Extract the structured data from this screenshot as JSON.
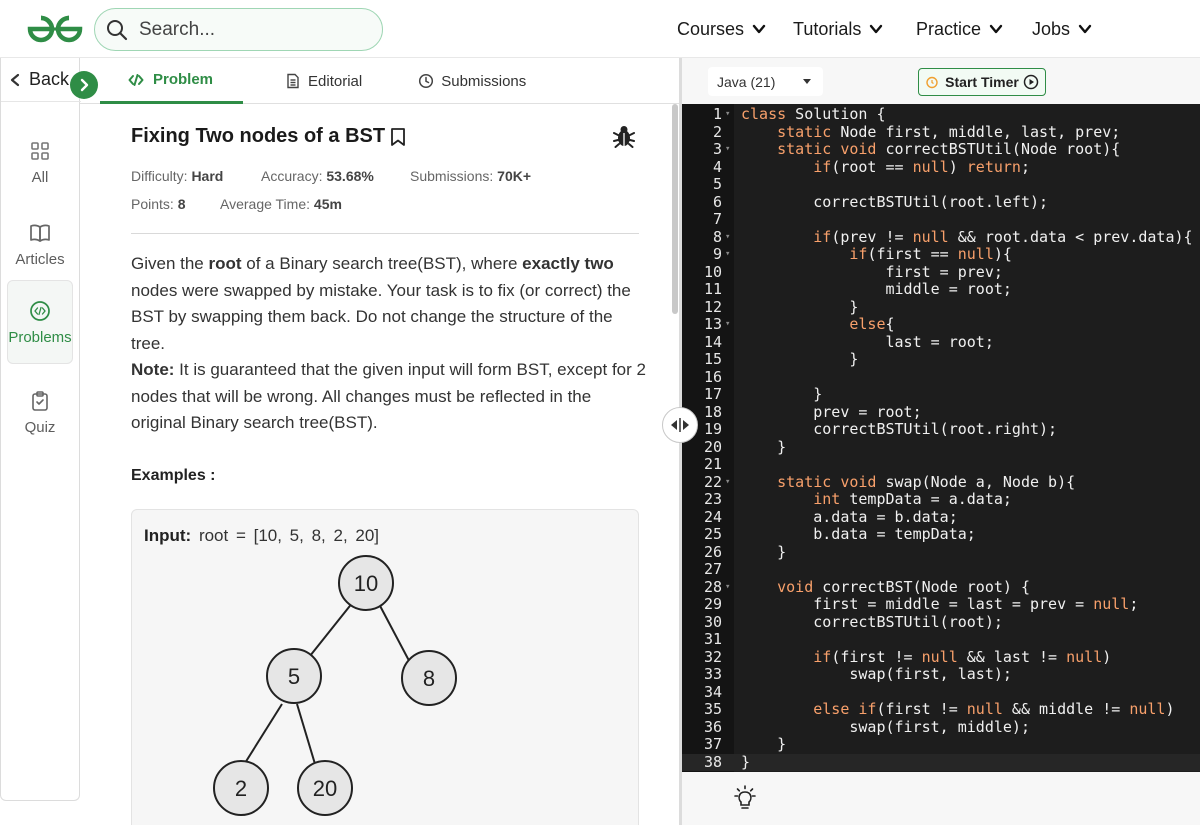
{
  "header": {
    "search_placeholder": "Search...",
    "nav": [
      "Courses",
      "Tutorials",
      "Practice",
      "Jobs"
    ]
  },
  "rail": {
    "back": "Back",
    "items": [
      {
        "label": "All",
        "icon": "grid-icon"
      },
      {
        "label": "Articles",
        "icon": "book-icon"
      },
      {
        "label": "Problems",
        "icon": "code-icon"
      },
      {
        "label": "Quiz",
        "icon": "clipboard-icon"
      }
    ],
    "active": "Problems"
  },
  "tabs": [
    "Problem",
    "Editorial",
    "Submissions"
  ],
  "problem": {
    "title": "Fixing Two nodes of a BST",
    "difficulty_label": "Difficulty:",
    "difficulty": "Hard",
    "accuracy_label": "Accuracy:",
    "accuracy": "53.68%",
    "submissions_label": "Submissions:",
    "submissions": "70K+",
    "points_label": "Points:",
    "points": "8",
    "avg_time_label": "Average Time:",
    "avg_time": "45m",
    "desc_p1_a": "Given the ",
    "desc_p1_b": "root",
    "desc_p1_c": " of a Binary search tree(BST), where ",
    "desc_p1_d": "exactly two",
    "desc_p1_e": " nodes were swapped by mistake. Your task is to fix (or correct) the BST by swapping them back. Do not change the structure of the tree.",
    "note_label": "Note:",
    "note_text": " It is guaranteed that the given input will form BST, except for 2 nodes that will be wrong. All changes must be reflected in the original Binary search tree(BST).",
    "examples_label": "Examples :",
    "input_label": "Input:",
    "input_value": "root = [10, 5, 8, 2, 20]",
    "tree_nodes": [
      "10",
      "5",
      "8",
      "2",
      "20"
    ]
  },
  "editor": {
    "language": "Java (21)",
    "timer_label": "Start Timer",
    "lines": [
      "class Solution {",
      "    static Node first, middle, last, prev;",
      "    static void correctBSTUtil(Node root){",
      "        if(root == null) return;",
      "",
      "        correctBSTUtil(root.left);",
      "",
      "        if(prev != null && root.data < prev.data){",
      "            if(first == null){",
      "                first = prev;",
      "                middle = root;",
      "            }",
      "            else{",
      "                last = root;",
      "            }",
      "",
      "        }",
      "        prev = root;",
      "        correctBSTUtil(root.right);",
      "    }",
      "",
      "    static void swap(Node a, Node b){",
      "        int tempData = a.data;",
      "        a.data = b.data;",
      "        b.data = tempData;",
      "    }",
      "",
      "    void correctBST(Node root) {",
      "        first = middle = last = prev = null;",
      "        correctBSTUtil(root);",
      "",
      "        if(first != null && last != null)",
      "            swap(first, last);",
      "",
      "        else if(first != null && middle != null)",
      "            swap(first, middle);",
      "    }",
      "}"
    ],
    "fold_lines": [
      1,
      3,
      8,
      9,
      13,
      22,
      28
    ]
  },
  "colors": {
    "brand_green": "#2f8d46",
    "keyword": "#f8a06b",
    "editor_bg": "#1d1d1d"
  }
}
